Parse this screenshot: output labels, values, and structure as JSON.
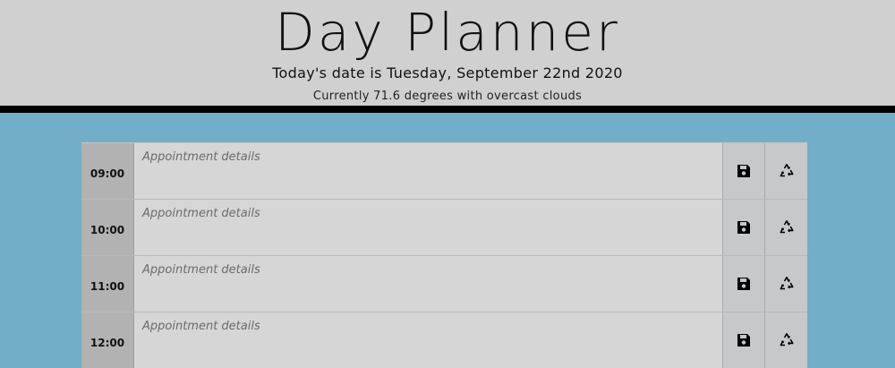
{
  "header": {
    "title": "Day Planner",
    "date_text": "Today's date is Tuesday, September 22nd 2020",
    "weather_text": "Currently 71.6 degrees with overcast clouds"
  },
  "planner": {
    "rows": [
      {
        "hour": "09:00",
        "placeholder": "Appointment details",
        "save_icon": "floppy-disk-icon",
        "clear_icon": "recycle-icon"
      },
      {
        "hour": "10:00",
        "placeholder": "Appointment details",
        "save_icon": "floppy-disk-icon",
        "clear_icon": "recycle-icon"
      },
      {
        "hour": "11:00",
        "placeholder": "Appointment details",
        "save_icon": "floppy-disk-icon",
        "clear_icon": "recycle-icon"
      },
      {
        "hour": "12:00",
        "placeholder": "Appointment details",
        "save_icon": "floppy-disk-icon",
        "clear_icon": "recycle-icon"
      }
    ]
  },
  "colors": {
    "page_background": "#72aec7",
    "header_background": "#d0d0d0",
    "header_border": "#000000",
    "hour_background": "#b2b2b2",
    "details_background": "#d6d6d6",
    "button_background": "#c6c8ca"
  }
}
